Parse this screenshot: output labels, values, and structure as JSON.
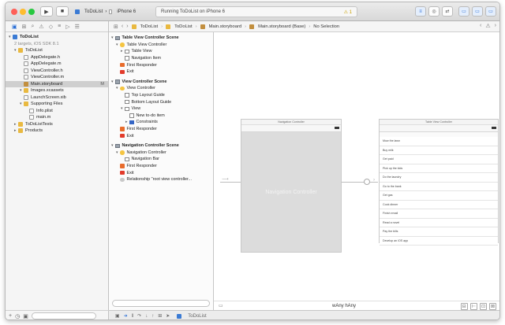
{
  "toolbar": {
    "scheme_name": "ToDoList",
    "scheme_sep": "›",
    "device_name": "iPhone 6",
    "status_text": "Running ToDoList on iPhone 6",
    "warning_count": "1",
    "colors": {
      "close": "#fe5f57",
      "minimize": "#febc2e",
      "zoom": "#28c840",
      "accent": "#2b6fd6"
    }
  },
  "navigator": {
    "items": [
      {
        "label": "ToDoList",
        "type": "project",
        "level": 0,
        "bold": true
      },
      {
        "label": "2 targets, iOS SDK 8.1",
        "type": "none",
        "level": 1,
        "muted": true
      },
      {
        "label": "ToDoList",
        "type": "folder",
        "level": 1
      },
      {
        "label": "AppDelegate.h",
        "type": "file",
        "level": 2
      },
      {
        "label": "AppDelegate.m",
        "type": "file",
        "level": 2
      },
      {
        "label": "ViewController.h",
        "type": "file",
        "level": 2
      },
      {
        "label": "ViewController.m",
        "type": "file",
        "level": 2
      },
      {
        "label": "Main.storyboard",
        "type": "storyboard",
        "level": 2,
        "selected": true,
        "badge": "M"
      },
      {
        "label": "Images.xcassets",
        "type": "folder",
        "level": 2
      },
      {
        "label": "LaunchScreen.xib",
        "type": "file",
        "level": 2
      },
      {
        "label": "Supporting Files",
        "type": "folder",
        "level": 2
      },
      {
        "label": "Info.plist",
        "type": "file",
        "level": 3
      },
      {
        "label": "main.m",
        "type": "file",
        "level": 3
      },
      {
        "label": "ToDoListTests",
        "type": "folder",
        "level": 1
      },
      {
        "label": "Products",
        "type": "folder",
        "level": 1
      }
    ]
  },
  "jumpbar": {
    "crumbs": [
      "ToDoList",
      "ToDoList",
      "Main.storyboard",
      "Main.storyboard (Base)",
      "No Selection"
    ]
  },
  "outline": {
    "rows": [
      {
        "label": "Table View Controller Scene",
        "type": "scene",
        "level": 0
      },
      {
        "label": "Table View Controller",
        "type": "vc",
        "level": 1
      },
      {
        "label": "Table View",
        "type": "view",
        "level": 2
      },
      {
        "label": "Navigation Item",
        "type": "view",
        "level": 2
      },
      {
        "label": "First Responder",
        "type": "fr",
        "level": 1
      },
      {
        "label": "Exit",
        "type": "exit",
        "level": 1
      },
      {
        "label": "View Controller Scene",
        "type": "scene",
        "level": 0
      },
      {
        "label": "View Controller",
        "type": "vc",
        "level": 1
      },
      {
        "label": "Top Layout Guide",
        "type": "view",
        "level": 2
      },
      {
        "label": "Bottom Layout Guide",
        "type": "view",
        "level": 2
      },
      {
        "label": "View",
        "type": "view",
        "level": 2
      },
      {
        "label": "New to-do item",
        "type": "view",
        "level": 3
      },
      {
        "label": "Constraints",
        "type": "cons",
        "level": 3
      },
      {
        "label": "First Responder",
        "type": "fr",
        "level": 1
      },
      {
        "label": "Exit",
        "type": "exit",
        "level": 1
      },
      {
        "label": "Navigation Controller Scene",
        "type": "scene",
        "level": 0
      },
      {
        "label": "Navigation Controller",
        "type": "nav",
        "level": 1
      },
      {
        "label": "Navigation Bar",
        "type": "view",
        "level": 2
      },
      {
        "label": "First Responder",
        "type": "fr",
        "level": 1
      },
      {
        "label": "Exit",
        "type": "exit",
        "level": 1
      },
      {
        "label": "Relationship \"root view controller...",
        "type": "seg",
        "level": 1
      }
    ]
  },
  "canvas": {
    "nav_scene_title": "Navigation Controller",
    "nav_content_label": "Navigation Controller",
    "table_scene_title": "Table View Controller",
    "table_cells": [
      "Mow the lawn",
      "Buy milk",
      "Get paid",
      "Pick up the kids",
      "Do the laundry",
      "Go to the bank",
      "Get gas",
      "Cook dinner",
      "Finish email",
      "Read a novel",
      "Pay the bills",
      "Develop an iOS app"
    ],
    "size_class": "wAny hAny"
  },
  "debug": {
    "target_name": "ToDoList"
  }
}
